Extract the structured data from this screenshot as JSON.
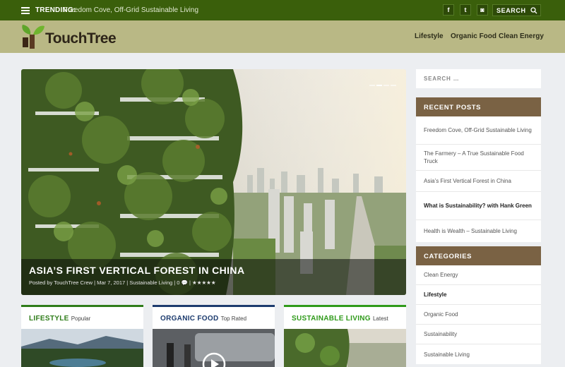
{
  "topbar": {
    "trending_label": "TRENDING:",
    "trending_text": "Freedom Cove, Off-Grid Sustainable Living",
    "search_label": "SEARCH",
    "social": [
      {
        "name": "facebook-icon",
        "glyph": "f"
      },
      {
        "name": "twitter-icon",
        "glyph": "t"
      },
      {
        "name": "instagram-icon",
        "glyph": "◙"
      }
    ]
  },
  "brand": {
    "name": "TouchTree",
    "colors": {
      "topbar": "#3a5f0b",
      "header": "#b9b885",
      "widget": "#7a6244"
    }
  },
  "nav": [
    "Lifestyle",
    "Organic Food",
    "Clean Energy"
  ],
  "hero": {
    "title": "ASIA’S FIRST VERTICAL FOREST IN CHINA",
    "meta": "Posted by TouchTree Crew | Mar 7, 2017 | Sustainable Living | 0 💬 | ★★★★★"
  },
  "cards": [
    {
      "category": "LIFESTYLE",
      "sub": "Popular",
      "color": "#2f7d1a"
    },
    {
      "category": "ORGANIC FOOD",
      "sub": "Top Rated",
      "color": "#1c3b6e"
    },
    {
      "category": "SUSTAINABLE LIVING",
      "sub": "Latest",
      "color": "#2f9a1a"
    }
  ],
  "sidebar": {
    "search_placeholder": "SEARCH …",
    "recent_title": "RECENT POSTS",
    "recent": [
      "Freedom Cove, Off-Grid Sustainable Living",
      "The Farmery – A True Sustainable Food Truck",
      "Asia’s First Vertical Forest in China",
      "What is Sustainability? with Hank Green",
      "Health is Wealth – Sustainable Living"
    ],
    "categories_title": "CATEGORIES",
    "categories": [
      "Clean Energy",
      "Lifestyle",
      "Organic Food",
      "Sustainability",
      "Sustainable Living"
    ],
    "selected_category": "Lifestyle"
  }
}
